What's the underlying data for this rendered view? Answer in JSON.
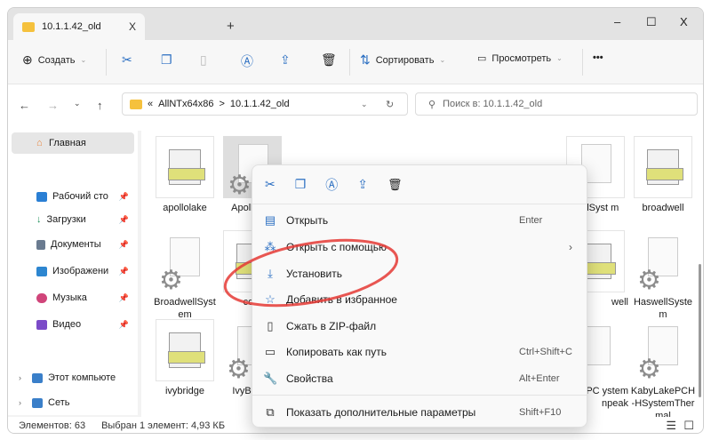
{
  "window": {
    "tab_title": "10.1.1.42_old",
    "new_tab": "+",
    "tab_close": "X",
    "minimize": "–",
    "maximize": "☐",
    "close": "X"
  },
  "toolbar": {
    "create": "Создать",
    "sort": "Сортировать",
    "view": "Просмотреть",
    "more": "•••"
  },
  "address": {
    "prefix": "«",
    "crumbs": [
      "AllNTx64x86",
      "10.1.1.42_old"
    ],
    "sep": ">",
    "search_placeholder": "Поиск в: 10.1.1.42_old"
  },
  "sidebar": {
    "items": [
      {
        "label": "Главная",
        "color": "#e8833a"
      },
      {
        "label": "Рабочий сто",
        "color": "#2a7fd4",
        "pinned": true
      },
      {
        "label": "Загрузки",
        "color": "#1e8f5a",
        "pinned": true
      },
      {
        "label": "Документы",
        "color": "#6a7b90",
        "pinned": true
      },
      {
        "label": "Изображени",
        "color": "#2d86d0",
        "pinned": true
      },
      {
        "label": "Музыка",
        "color": "#d0457a",
        "pinned": true
      },
      {
        "label": "Видео",
        "color": "#7b4bc8",
        "pinned": true
      },
      {
        "label": "Этот компьюте",
        "color": "#3a7fc9"
      },
      {
        "label": "Сеть",
        "color": "#3a7fc9"
      }
    ]
  },
  "files": [
    {
      "label": "apollolake",
      "type": "inf"
    },
    {
      "label": "Apollo yst",
      "type": "sys",
      "selected": true
    },
    {
      "label": "wellSyst m",
      "type": "sys"
    },
    {
      "label": "broadwell",
      "type": "inf"
    },
    {
      "label": "BroadwellSystem",
      "type": "sys"
    },
    {
      "label": "com",
      "type": "inf"
    },
    {
      "label": "well",
      "type": "inf"
    },
    {
      "label": "HaswellSystem",
      "type": "sys"
    },
    {
      "label": "ivybridge",
      "type": "inf"
    },
    {
      "label": "IvyBric te",
      "type": "sys"
    },
    {
      "label": "akePC ystem npeak",
      "type": "sys"
    },
    {
      "label": "KabyLakePCH-HSystemThermal",
      "type": "sys"
    }
  ],
  "status": {
    "count": "Элементов: 63",
    "selected": "Выбран 1 элемент: 4,93 КБ"
  },
  "context_menu": {
    "items": [
      {
        "label": "Открыть",
        "shortcut": "Enter",
        "icon": "notepad-icon"
      },
      {
        "label": "Открыть с помощью",
        "submenu": "›",
        "icon": "open-with-icon"
      },
      {
        "label": "Установить",
        "icon": "download-icon"
      },
      {
        "label": "Добавить в избранное",
        "icon": "star-icon"
      },
      {
        "label": "Сжать в ZIP-файл",
        "icon": "zip-icon"
      },
      {
        "label": "Копировать как путь",
        "shortcut": "Ctrl+Shift+C",
        "icon": "path-icon"
      },
      {
        "label": "Свойства",
        "shortcut": "Alt+Enter",
        "icon": "wrench-icon"
      },
      {
        "label": "Показать дополнительные параметры",
        "shortcut": "Shift+F10",
        "icon": "more-options-icon"
      }
    ]
  },
  "annotation_color": "#e53935"
}
